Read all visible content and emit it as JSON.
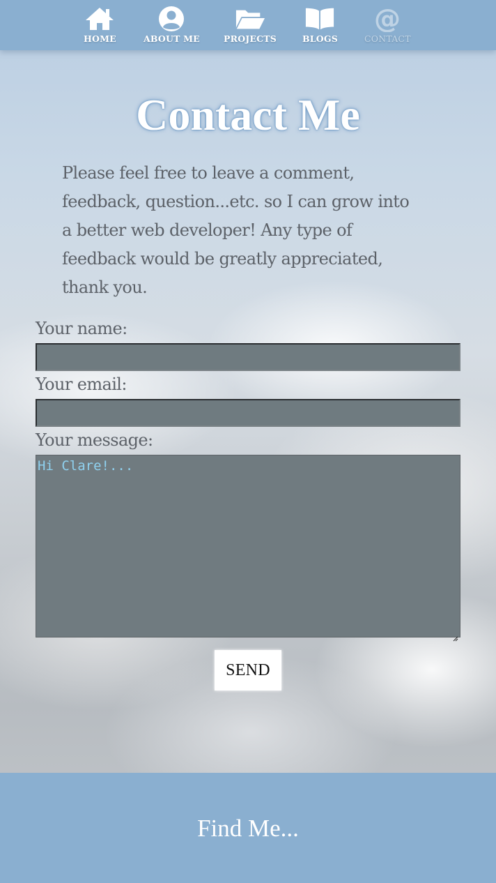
{
  "nav": {
    "items": [
      {
        "label": "HOME",
        "icon": "home-icon"
      },
      {
        "label": "ABOUT ME",
        "icon": "user-circle-icon"
      },
      {
        "label": "PROJECTS",
        "icon": "folder-open-icon"
      },
      {
        "label": "BLOGS",
        "icon": "book-open-icon"
      },
      {
        "label": "CONTACT",
        "icon": "at-sign-icon",
        "active": true
      }
    ]
  },
  "main": {
    "title": "Contact Me",
    "intro_lines": [
      "Please feel free to leave a comment,",
      "feedback, question...etc. so I can grow into",
      "a better web developer! Any type of",
      "feedback would be greatly appreciated,",
      "thank you."
    ]
  },
  "form": {
    "name_label": "Your name:",
    "name_value": "",
    "email_label": "Your email:",
    "email_value": "",
    "message_label": "Your message:",
    "message_placeholder": "Hi Clare!...",
    "send_label": "SEND"
  },
  "footer": {
    "title": "Find Me..."
  },
  "colors": {
    "nav_bg": "#8aafd0",
    "title_glow": "#5a8cbe",
    "body_text": "#5c6168",
    "input_bg": "#6f7b80",
    "placeholder": "#8fd1ef"
  }
}
